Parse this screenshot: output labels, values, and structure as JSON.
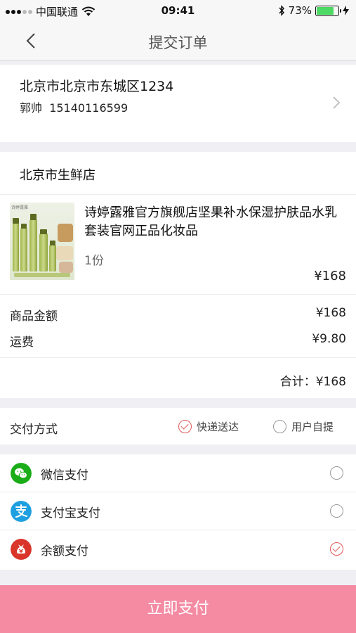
{
  "status_bar": {
    "carrier": "中国联通",
    "time": "09:41",
    "battery": "73%",
    "battery_level": 0.73
  },
  "nav": {
    "title": "提交订单"
  },
  "address": {
    "line": "北京市北京市东城区1234",
    "name": "郭帅",
    "phone": "15140116599"
  },
  "shop": {
    "name": "北京市生鲜店"
  },
  "product": {
    "title": "诗婷露雅官方旗舰店坚果补水保湿护肤品水乳套装官网正品化妆品",
    "quantity": "1份",
    "price": "¥168",
    "image_caption": "诗婷露雅"
  },
  "summary": {
    "goods_label": "商品金额",
    "goods_value": "¥168",
    "shipping_label": "运费",
    "shipping_value": "¥9.80",
    "total_text": "合计：¥168"
  },
  "delivery": {
    "label": "交付方式",
    "options": [
      {
        "label": "快递送达",
        "checked": true
      },
      {
        "label": "用户自提",
        "checked": false
      }
    ]
  },
  "payment": {
    "methods": [
      {
        "label": "微信支付",
        "icon": "wechat-icon",
        "color": "#1aad19",
        "checked": false
      },
      {
        "label": "支付宝支付",
        "icon": "alipay-icon",
        "color": "#1e9fe0",
        "checked": false
      },
      {
        "label": "余额支付",
        "icon": "balance-icon",
        "color": "#d9352b",
        "checked": true
      }
    ]
  },
  "submit_label": "立即支付",
  "colors": {
    "accent": "#e05a57",
    "submit_bg": "#f48ba3"
  }
}
